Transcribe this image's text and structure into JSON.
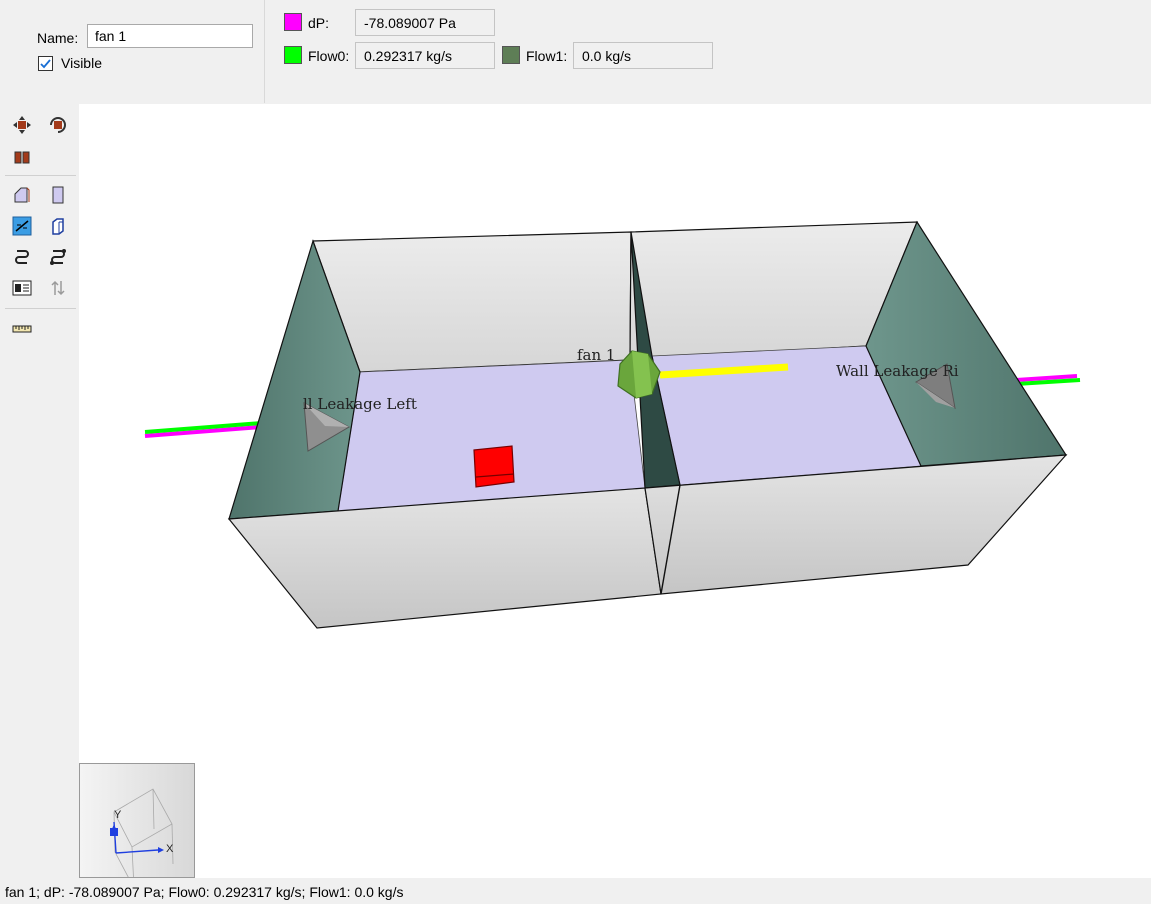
{
  "props": {
    "name_label": "Name:",
    "name_value": "fan 1",
    "visible_label": "Visible",
    "visible_checked": true
  },
  "results": {
    "dp": {
      "label": "dP:",
      "value": "-78.089007 Pa",
      "color": "#ff00ff"
    },
    "flow0": {
      "label": "Flow0:",
      "value": "0.292317 kg/s",
      "color": "#00ff00"
    },
    "flow1": {
      "label": "Flow1:",
      "value": "0.0 kg/s",
      "color": "#5e7e56"
    }
  },
  "toolbar": [
    {
      "name": "pan-tool-icon"
    },
    {
      "name": "rotate-tool-icon"
    },
    {
      "name": "orbit-tool-icon"
    },
    {
      "name": "perspective-view-icon"
    },
    {
      "name": "wall-view-icon"
    },
    {
      "name": "show-flows-icon"
    },
    {
      "name": "show-volumes-icon"
    },
    {
      "name": "path-tool-icon"
    },
    {
      "name": "path-edit-icon"
    },
    {
      "name": "labels-toggle-icon"
    },
    {
      "name": "sort-icon"
    },
    {
      "name": "ruler-icon"
    }
  ],
  "scene": {
    "labels": {
      "leak_left": "ll Leakage Left",
      "fan": "fan 1",
      "leak_right": "Wall Leakage Ri"
    },
    "colors": {
      "wall": "#d9d9d9",
      "wall_dark": "#5e877d",
      "floor": "#cfcaf0",
      "fan": "#6aa63c",
      "fan_flow": "#ffff00",
      "flow0": "#00ff00",
      "dp": "#ff00ff",
      "occupant": "#ff0000"
    }
  },
  "axes": {
    "x": "X",
    "y": "Y"
  },
  "status": "fan 1; dP: -78.089007 Pa; Flow0: 0.292317 kg/s; Flow1: 0.0 kg/s"
}
